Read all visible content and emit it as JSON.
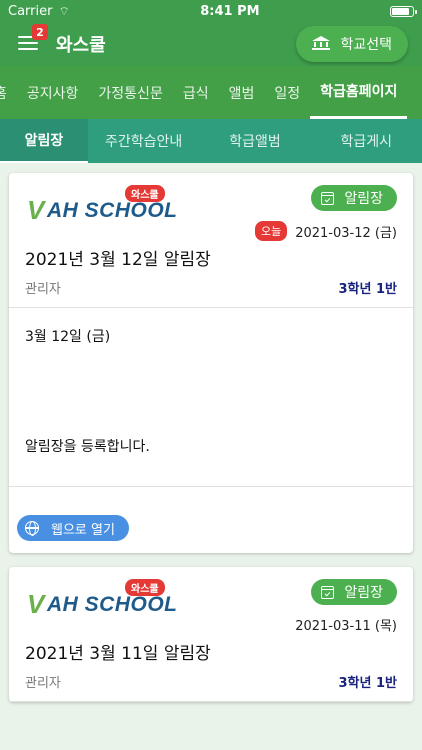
{
  "status": {
    "carrier": "Carrier",
    "time": "8:41 PM"
  },
  "appbar": {
    "title": "와스쿨",
    "badge": "2",
    "school_button": "학교선택"
  },
  "top_tabs": [
    "홈",
    "공지사항",
    "가정통신문",
    "급식",
    "앨범",
    "일정",
    "학급홈페이지"
  ],
  "sub_tabs": [
    "알림장",
    "주간학습안내",
    "학급앨범",
    "학급게시"
  ],
  "logo": {
    "tag": "와스쿨",
    "text": "AH SCHOOL"
  },
  "cards": [
    {
      "kind": "알림장",
      "today": "오늘",
      "date": "2021-03-12 (금)",
      "title": "2021년 3월 12일 알림장",
      "author": "관리자",
      "class": "3학년 1반",
      "body_line1": "3월 12일 (금)",
      "body_line2": "알림장을 등록합니다.",
      "web_button": "웹으로 열기"
    },
    {
      "kind": "알림장",
      "date": "2021-03-11 (목)",
      "title": "2021년 3월 11일 알림장",
      "author": "관리자",
      "class": "3학년 1반"
    }
  ],
  "colors": {
    "primary": "#3f9e4d",
    "subtab": "#2e9e7e",
    "accent": "#4caf50",
    "link": "#4a90e2",
    "badge": "#e53935"
  }
}
